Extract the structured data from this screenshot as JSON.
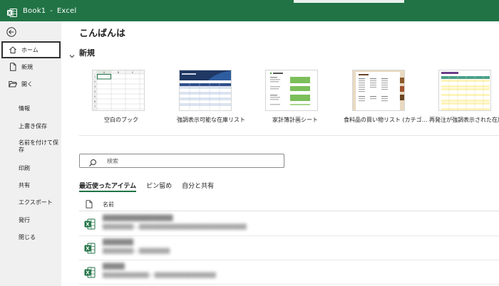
{
  "app": {
    "title": "Book1",
    "separator": "-",
    "app_name": "Excel"
  },
  "colors": {
    "brand": "#217346",
    "sidebar_bg": "#f0f0f0"
  },
  "sidebar": {
    "back_icon": "back-arrow-icon",
    "primary": [
      {
        "label": "ホーム",
        "icon": "home-icon",
        "active": true
      },
      {
        "label": "新規",
        "icon": "new-document-icon"
      },
      {
        "label": "開く",
        "icon": "open-folder-icon"
      }
    ],
    "secondary": [
      {
        "label": "情報"
      },
      {
        "label": "上書き保存"
      },
      {
        "label": "名前を付けて保存"
      },
      {
        "label": "印刷"
      },
      {
        "label": "共有"
      },
      {
        "label": "エクスポート"
      },
      {
        "label": "発行"
      },
      {
        "label": "閉じる"
      }
    ]
  },
  "main": {
    "greeting": "こんばんは",
    "new_section_title": "新規",
    "templates": [
      {
        "label": "空白のブック"
      },
      {
        "label": "強調表示可能な在庫リスト"
      },
      {
        "label": "家計簿計画シート"
      },
      {
        "label": "食料品の買い物リスト (カテゴ…"
      },
      {
        "label": "再発注が強調表示された在庫…"
      }
    ],
    "blank_grid": {
      "columns": [
        "A",
        "B",
        "C"
      ],
      "rows": [
        "1",
        "2",
        "3",
        "4",
        "5",
        "6",
        "7"
      ]
    },
    "search": {
      "placeholder": "検索"
    },
    "tabs": [
      {
        "label": "最近使ったアイテム",
        "active": true
      },
      {
        "label": "ピン留め"
      },
      {
        "label": "自分と共有"
      }
    ],
    "list_header": {
      "name": "名前"
    },
    "files": [
      {
        "name": "████████████████",
        "path": "████████ ▸ ████████████████████████████"
      },
      {
        "name": "███████",
        "path": "████████ ▸ ████████"
      },
      {
        "name": "█████",
        "path": "████████████ ▸ ████████████████"
      }
    ]
  }
}
